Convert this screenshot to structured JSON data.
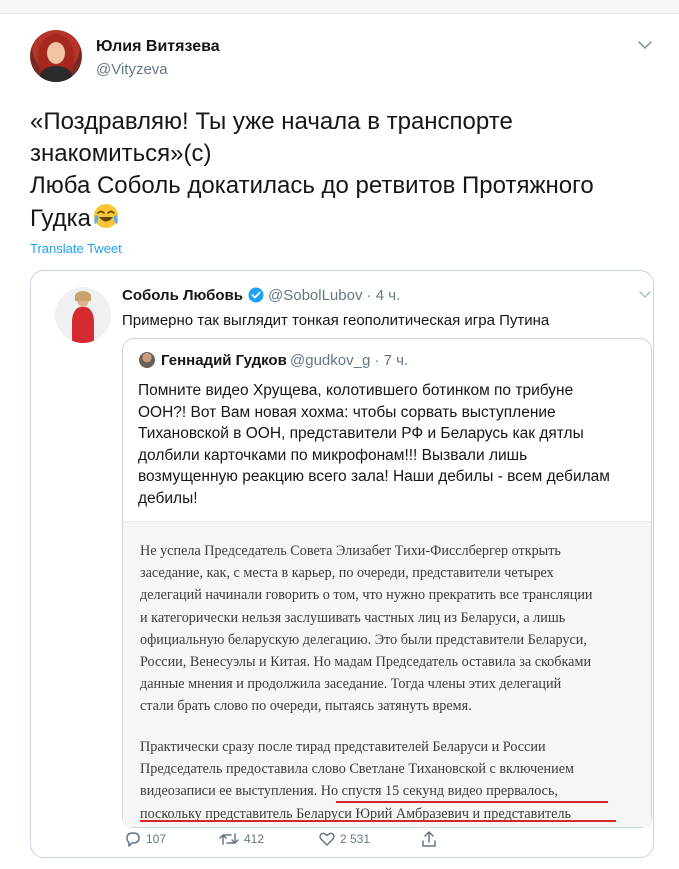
{
  "tweet": {
    "author_name": "Юлия Витязева",
    "author_handle": "@Vityzeva",
    "text_lines": [
      "«Поздравляю! Ты уже начала в транспорте",
      "знакомиться»(с)",
      "Люба Соболь докатилась до ретвитов Протяжного",
      "Гудка"
    ],
    "translate_label": "Translate Tweet"
  },
  "quote": {
    "author_name": "Соболь Любовь",
    "meta": "@SobolLubov · 4 ч.",
    "text": "Примерно так выглядит тонкая геополитическая игра Путина",
    "nested": {
      "author_name": "Геннадий Гудков",
      "meta": "@gudkov_g · 7 ч.",
      "text_lines": [
        "Помните видео Хрущева, колотившего ботинком по трибуне",
        "ООН?! Вот Вам новая хохма: чтобы сорвать выступление",
        "Тихановской в ООН, представители РФ и Беларусь как дятлы",
        "долбили карточками по микрофонам!!! Вызвали лишь",
        "возмущенную реакцию всего зала! Наши дебилы - всем дебилам",
        "дебилы!"
      ],
      "image_paragraph1": [
        "Не успела Председатель Совета Элизабет Тихи-Фисслбергер открыть",
        "заседание, как, с места в карьер, по очереди, представители четырех",
        "делегаций начинали говорить о том, что нужно прекратить все трансляции",
        "и категорически нельзя заслушивать частных лиц из Беларуси, а лишь",
        "официальную беларускую делегацию. Это были представители Беларуси,",
        "России, Венесуэлы и Китая. Но мадам Председатель оставила за скобками",
        "данные мнения и продолжила заседание. Тогда члены этих делегаций",
        "стали брать слово по очереди, пытаясь затянуть время."
      ],
      "image_paragraph2": [
        "Практически сразу после тирад представителей Беларуси и России",
        "Председатель предоставила слово Светлане Тихановской с включением",
        "видеозаписи ее выступления. Но спустя 15 секунд видео прервалось,",
        "поскольку представитель Беларуси Юрий Амбразевич и представитель"
      ]
    }
  },
  "actions": {
    "replies": "107",
    "retweets": "412",
    "likes": "2 531"
  },
  "colors": {
    "link": "#1da1f2",
    "muted": "#657786",
    "border": "#ccd6dd",
    "underline": "#d7262c"
  }
}
